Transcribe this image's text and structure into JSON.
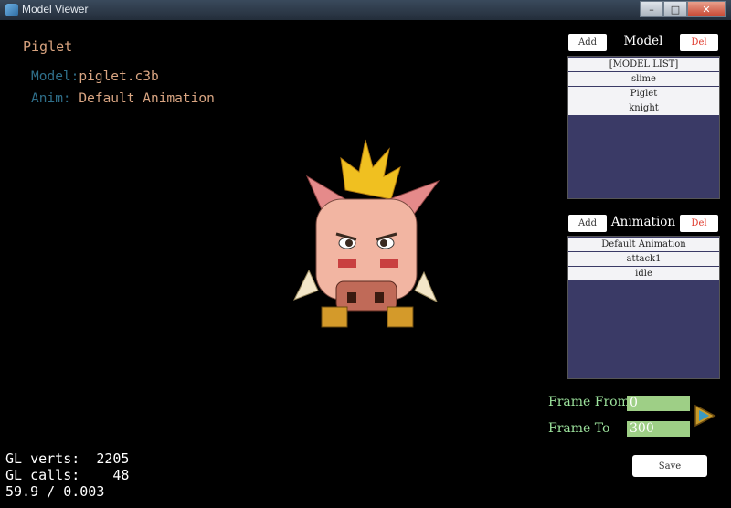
{
  "window": {
    "title": "Model Viewer",
    "buttons": {
      "minimize": "–",
      "maximize": "□",
      "close": "✕"
    }
  },
  "hud": {
    "model_name": "Piglet",
    "model_label": "Model:",
    "model_value": "piglet.c3b",
    "anim_label": "Anim:",
    "anim_value": "Default Animation"
  },
  "model_panel": {
    "add_label": "Add",
    "title": "Model",
    "del_label": "Del",
    "items": [
      "[MODEL LIST]",
      "slime",
      "Piglet",
      "knight"
    ]
  },
  "animation_panel": {
    "add_label": "Add",
    "title": "Animation",
    "del_label": "Del",
    "items": [
      "Default Animation",
      "attack1",
      "idle"
    ]
  },
  "frame": {
    "from_label": "Frame From",
    "from_value": "0",
    "to_label": "Frame To",
    "to_value": "300"
  },
  "save_label": "Save",
  "stats": {
    "verts_line": "GL verts:  2205",
    "calls_line": "GL calls:    48",
    "fps_line": "59.9 / 0.003"
  },
  "colors": {
    "panel_bg": "#3a3a66",
    "frame_input": "#9ecf86",
    "del_red": "#e03a2c"
  }
}
